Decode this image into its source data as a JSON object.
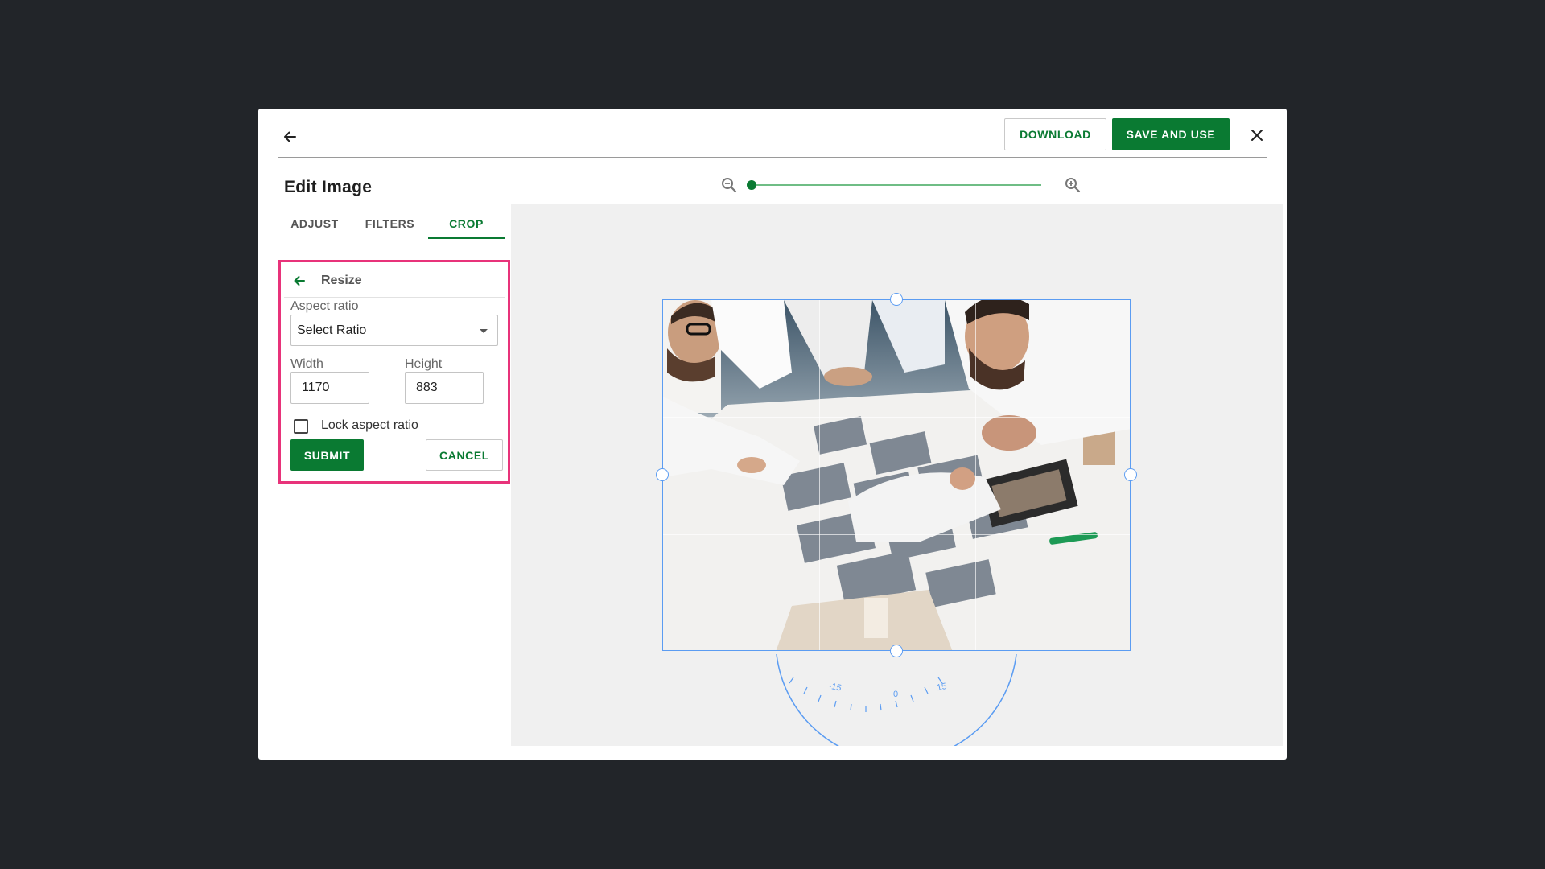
{
  "header": {
    "download_label": "DOWNLOAD",
    "save_label": "SAVE AND USE"
  },
  "page_title": "Edit Image",
  "tabs": [
    {
      "label": "ADJUST"
    },
    {
      "label": "FILTERS"
    },
    {
      "label": "CROP",
      "active": true
    }
  ],
  "resize_panel": {
    "heading": "Resize",
    "aspect_ratio_label": "Aspect ratio",
    "aspect_ratio_value": "Select Ratio",
    "width_label": "Width",
    "width_value": "1170",
    "height_label": "Height",
    "height_value": "883",
    "lock_label": "Lock aspect ratio",
    "lock_checked": false,
    "submit_label": "SUBMIT",
    "cancel_label": "CANCEL"
  },
  "zoom": {
    "level": 0
  },
  "rotation_dial": {
    "labels": [
      "-15",
      "0",
      "15"
    ]
  },
  "colors": {
    "accent": "#0a7a32",
    "highlight": "#e8337a",
    "crop_frame": "#5b9cf2",
    "backdrop": "#222529"
  }
}
